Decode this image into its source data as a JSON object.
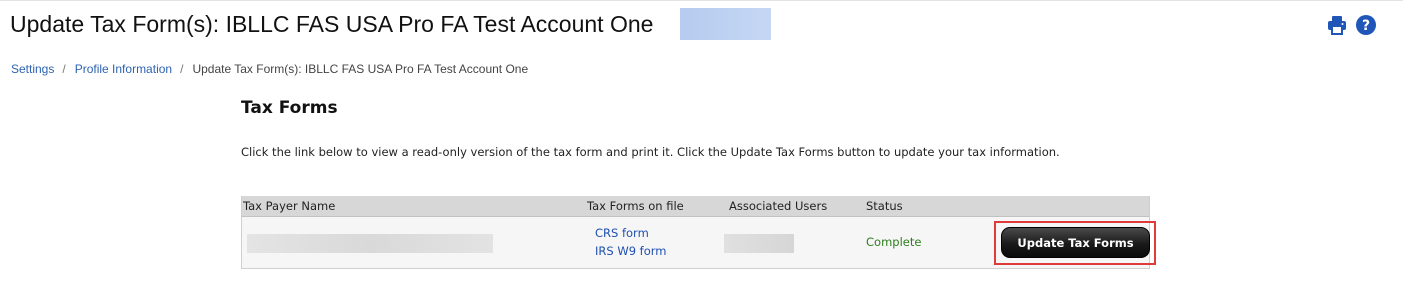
{
  "header": {
    "title": "Update Tax Form(s): IBLLC FAS USA Pro FA Test Account One",
    "print_icon": "printer-icon",
    "help_icon": "question-circle-icon",
    "icon_color": "#1f56b8"
  },
  "breadcrumb": {
    "items": [
      "Settings",
      "Profile Information"
    ],
    "separator": "/",
    "current": "Update Tax Form(s): IBLLC FAS USA Pro FA Test Account One"
  },
  "main": {
    "section_title": "Tax Forms",
    "instructions": "Click the link below to view a read-only version of the tax form and print it. Click the Update Tax Forms button to update your tax information."
  },
  "table": {
    "columns": [
      "Tax Payer Name",
      "Tax Forms on file",
      "Associated Users",
      "Status"
    ],
    "rows": [
      {
        "forms": [
          "CRS form",
          "IRS W9 form"
        ],
        "status": "Complete",
        "status_color": "#2e7d1e"
      }
    ]
  },
  "actions": {
    "update_button": "Update Tax Forms",
    "highlight_color": "#e03b3b"
  }
}
